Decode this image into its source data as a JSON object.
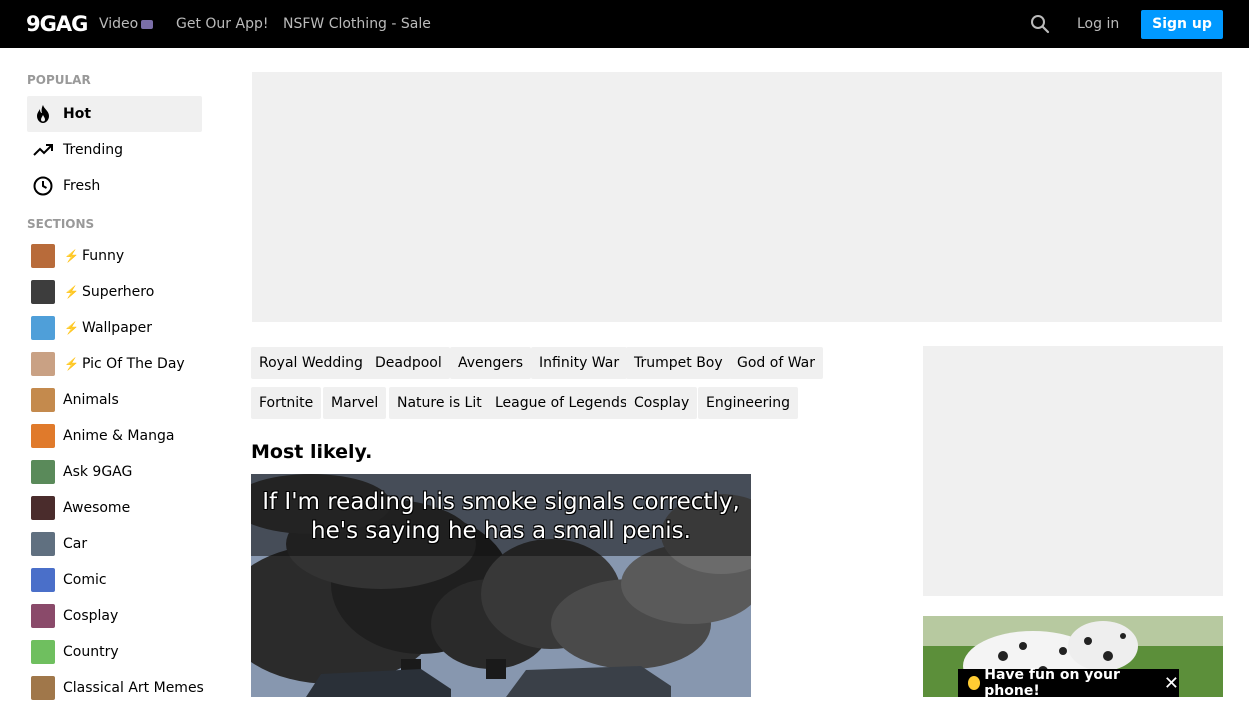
{
  "header": {
    "logo": "9GAG",
    "nav": [
      "Video",
      "Get Our App!",
      "NSFW Clothing - Sale"
    ],
    "login": "Log in",
    "signup": "Sign up"
  },
  "sidebar": {
    "popular_heading": "POPULAR",
    "popular": [
      {
        "label": "Hot",
        "icon": "flame-icon"
      },
      {
        "label": "Trending",
        "icon": "trending-icon"
      },
      {
        "label": "Fresh",
        "icon": "clock-icon"
      }
    ],
    "sections_heading": "SECTIONS",
    "sections": [
      {
        "label": "Funny",
        "bolt": true,
        "color": "#b86b3a"
      },
      {
        "label": "Superhero",
        "bolt": true,
        "color": "#3d3d3d"
      },
      {
        "label": "Wallpaper",
        "bolt": true,
        "color": "#4f9fd9"
      },
      {
        "label": "Pic Of The Day",
        "bolt": true,
        "color": "#c9a184"
      },
      {
        "label": "Animals",
        "bolt": false,
        "color": "#c48a4d"
      },
      {
        "label": "Anime & Manga",
        "bolt": false,
        "color": "#e07a2b"
      },
      {
        "label": "Ask 9GAG",
        "bolt": false,
        "color": "#5a8a5a"
      },
      {
        "label": "Awesome",
        "bolt": false,
        "color": "#4a2c2c"
      },
      {
        "label": "Car",
        "bolt": false,
        "color": "#607080"
      },
      {
        "label": "Comic",
        "bolt": false,
        "color": "#4a6fc9"
      },
      {
        "label": "Cosplay",
        "bolt": false,
        "color": "#8a4a6a"
      },
      {
        "label": "Country",
        "bolt": false,
        "color": "#6fbf5f"
      },
      {
        "label": "Classical Art Memes",
        "bolt": false,
        "color": "#a0774a"
      }
    ]
  },
  "tags": [
    "Royal Wedding",
    "Deadpool",
    "Avengers",
    "Infinity War",
    "Trumpet Boy",
    "God of War",
    "Fortnite",
    "Marvel",
    "Nature is Lit",
    "League of Legends",
    "Cosplay",
    "Engineering"
  ],
  "post": {
    "title": "Most likely.",
    "caption_line1": "If I'm reading his smoke signals correctly,",
    "caption_line2": "he's saying he has a small penis."
  },
  "promo": {
    "text": "Have fun on your phone!",
    "close": "✕"
  },
  "colors": {
    "accent": "#0099ff",
    "bolt": "#f5c518",
    "tag_bg": "#f0f0f0"
  }
}
